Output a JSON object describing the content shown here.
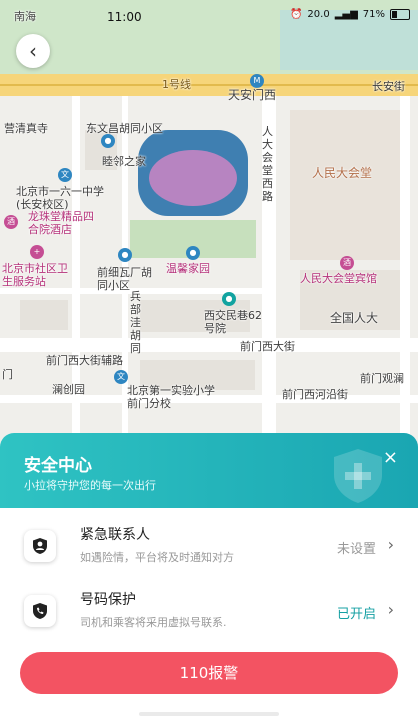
{
  "status_bar": {
    "carrier": "南海",
    "time": "11:00",
    "network": "20.0",
    "battery": "71%"
  },
  "map": {
    "labels": {
      "line1": "1号线",
      "tiananmen_west": "天安门西",
      "changan_street": "长安街",
      "qingzhen": "营清真寺",
      "dongwanchang": "东文昌胡同小区",
      "mulinzhijia": "睦邻之家",
      "great_hall_west_road": "人大会堂西路",
      "great_hall": "人民大会堂",
      "school161": "北京市一六一中学(长安校区)",
      "longquan": "龙珠堂精品四合院酒店",
      "community_health": "北京市社区卫生服务站",
      "qianxi": "前细瓦厂胡同小区",
      "wenxin": "温馨家园",
      "great_hall_hotel": "人民大会堂宾馆",
      "bingbu": "兵部洼胡同",
      "xijiao": "西交民巷62号院",
      "npc": "全国人大",
      "qianmen_west": "前门西大街",
      "qianmen_fu": "前门西大街辅路",
      "qianmen_west2": "前门西大街",
      "lanju": "澜创园",
      "no1_school": "北京第一实验小学前门分校",
      "qianmen_heyan": "前门西河沿街",
      "qianmen_guanlan": "前门观澜",
      "men": "门"
    }
  },
  "sheet": {
    "title": "安全中心",
    "subtitle": "小拉将守护您的每一次出行",
    "close_symbol": "×",
    "rows": [
      {
        "title": "紧急联系人",
        "subtitle": "如遇险情，平台将及时通知对方",
        "status": "未设置"
      },
      {
        "title": "号码保护",
        "subtitle": "司机和乘客将采用虚拟号联系.",
        "status": "已开启"
      }
    ]
  },
  "police_button": "110报警",
  "colors": {
    "teal": "#1aa6b2",
    "red": "#f35362"
  }
}
